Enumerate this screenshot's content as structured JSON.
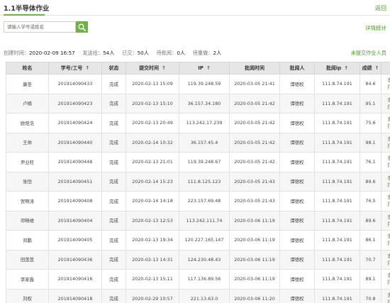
{
  "header": {
    "title": "1.1半导体作业",
    "back_label": "返回"
  },
  "search": {
    "placeholder": "请输入学号或姓名"
  },
  "toolbar": {
    "detail_stats_label": "详情统计"
  },
  "summary": {
    "created_label": "创建时间：",
    "created_value": "2020-02-09 16:57",
    "sent_label": "发送给：",
    "sent_value": "54人",
    "submitted_label": "已交：",
    "submitted_value": "50人",
    "pending_label": "待批阅：",
    "pending_value": "0人",
    "redo_label": "待重做：",
    "redo_value": "2人",
    "unsubmitted_link": "未提交作业人员"
  },
  "table": {
    "columns": [
      "姓名",
      "学号/工号",
      "状态",
      "提交时间",
      "IP",
      "批阅时间",
      "批阅人",
      "批阅ip",
      "成绩",
      ""
    ],
    "view_label": "查看",
    "print_label": "打回",
    "rows": [
      {
        "name": "康茎",
        "id": "201914090433",
        "status": "完成",
        "submit_time": "2020-02-13 15:09",
        "ip": "119.39.248.59",
        "review_time": "2020-03-05 21:41",
        "reviewer": "谭德权",
        "review_ip": "111.8.74.191",
        "score": "84.6"
      },
      {
        "name": "卢楠",
        "id": "201914090423",
        "status": "完成",
        "submit_time": "2020-02-13 15:10",
        "ip": "36.157.34.180",
        "review_time": "2020-03-05 21:42",
        "reviewer": "谭德权",
        "review_ip": "111.8.74.191",
        "score": "95.1"
      },
      {
        "name": "欧阳浩",
        "id": "201914090424",
        "status": "完成",
        "submit_time": "2020-02-13 20:49",
        "ip": "113.242.17.239",
        "review_time": "2020-03-05 21:42",
        "reviewer": "谭德权",
        "review_ip": "111.8.74.191",
        "score": "75.6"
      },
      {
        "name": "王帅",
        "id": "201914090440",
        "status": "完成",
        "submit_time": "2020-02-14 10:32",
        "ip": "36.157.45.4",
        "review_time": "2020-03-05 21:42",
        "reviewer": "谭德权",
        "review_ip": "111.8.74.191",
        "score": "98.1"
      },
      {
        "name": "尹业旺",
        "id": "201914090448",
        "status": "完成",
        "submit_time": "2020-02-13 21:01",
        "ip": "119.39.248.67",
        "review_time": "2020-03-05 21:42",
        "reviewer": "谭德权",
        "review_ip": "111.8.74.191",
        "score": "76.1"
      },
      {
        "name": "张恺",
        "id": "201914090451",
        "status": "完成",
        "submit_time": "2020-02-14 15:23",
        "ip": "111.8.125.123",
        "review_time": "2020-03-05 21:43",
        "reviewer": "谭德权",
        "review_ip": "111.8.74.191",
        "score": "89.6"
      },
      {
        "name": "贺啊涛",
        "id": "201914090408",
        "status": "完成",
        "submit_time": "2020-02-14 14:18",
        "ip": "223.157.69.48",
        "review_time": "2020-03-05 21:43",
        "reviewer": "谭德权",
        "review_ip": "111.8.74.191",
        "score": "76.5"
      },
      {
        "name": "邓畅维",
        "id": "201914090404",
        "status": "完成",
        "submit_time": "2020-02-13 12:53",
        "ip": "113.242.111.74",
        "review_time": "2020-03-06 11:19",
        "reviewer": "谭德权",
        "review_ip": "111.8.74.191",
        "score": "89.6"
      },
      {
        "name": "邓鹏",
        "id": "201914090405",
        "status": "完成",
        "submit_time": "2020-02-13 19:34",
        "ip": "120.227.165.147",
        "review_time": "2020-03-06 11:19",
        "reviewer": "谭德权",
        "review_ip": "111.8.74.191",
        "score": "86.1"
      },
      {
        "name": "田莲莲",
        "id": "201914090436",
        "status": "完成",
        "submit_time": "2020-02-13 14:31",
        "ip": "124.230.48.43",
        "review_time": "2020-03-06 11:19",
        "reviewer": "谭德权",
        "review_ip": "111.8.74.191",
        "score": "70.7"
      },
      {
        "name": "李家鑫",
        "id": "201914090416",
        "status": "完成",
        "submit_time": "2020-02-13 15:11",
        "ip": "117.136.89.56",
        "review_time": "2020-03-06 11:19",
        "reviewer": "谭德权",
        "review_ip": "111.8.74.191",
        "score": "89.1"
      },
      {
        "name": "刘权",
        "id": "201914090418",
        "status": "完成",
        "submit_time": "2020-02-29 10:57",
        "ip": "221.13.63.0",
        "review_time": "2020-03-06 11:20",
        "reviewer": "谭德权",
        "review_ip": "111.8.74.191",
        "score": "70.8"
      }
    ]
  }
}
